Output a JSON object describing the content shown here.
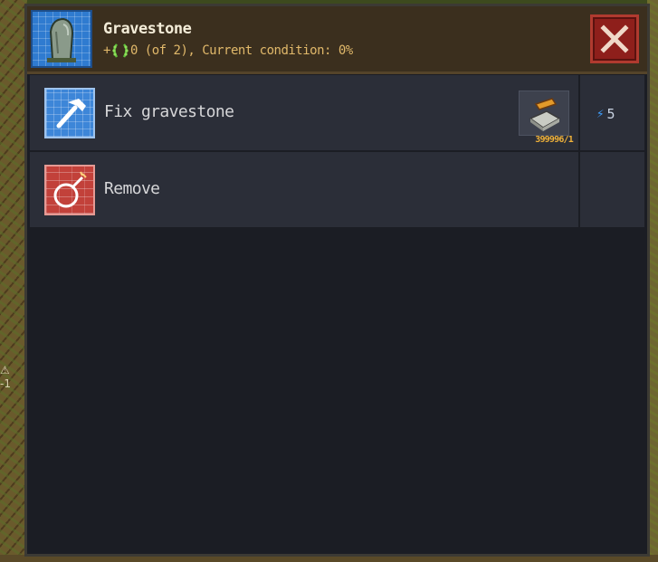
{
  "panel": {
    "title": "Gravestone",
    "subtitle_prefix": "+",
    "subtitle_text": "0 (of 2), Current condition: 0%",
    "icons": {
      "header": "gravestone-icon",
      "subtitle": "laurel-icon",
      "close": "close-icon"
    }
  },
  "actions": [
    {
      "label": "Fix gravestone",
      "icon": "hammer-icon",
      "resource_icon": "stone-slab-icon",
      "resource_count": "399996/1",
      "energy_cost": "5",
      "energy_icon": "lightning-icon"
    },
    {
      "label": "Remove",
      "icon": "bomb-icon"
    }
  ],
  "world": {
    "side_marker": [
      "⚠",
      "-1"
    ]
  },
  "colors": {
    "header_bg": "#3b2f1e",
    "panel_bg": "#1b1d24",
    "row_bg": "#2b2e38",
    "accent_gold": "#e0b86a",
    "close_red": "#8e1f1b",
    "energy_blue": "#3fa0ff"
  }
}
